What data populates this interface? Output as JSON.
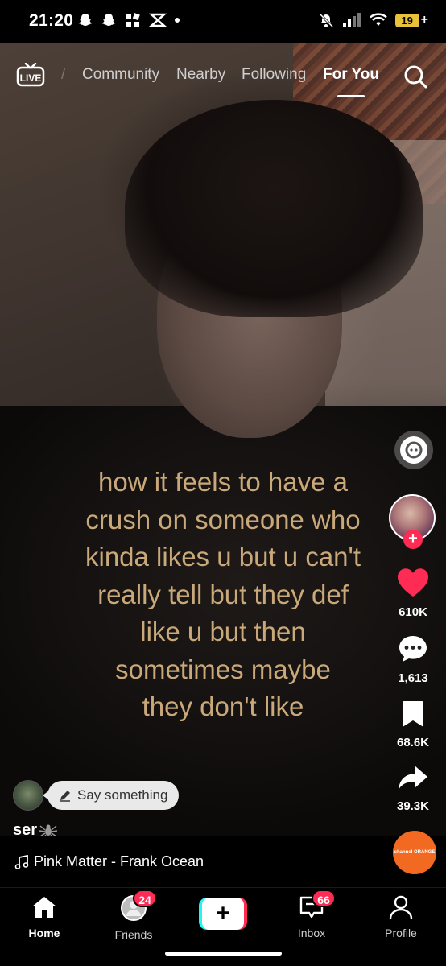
{
  "status_bar": {
    "time": "21:20",
    "left_icons": [
      "snapchat-icon",
      "snapchat-icon",
      "app-icon",
      "capcut-icon",
      "dot-icon"
    ],
    "battery": "19",
    "battery_charging": "+"
  },
  "top_nav": {
    "live_label": "LIVE",
    "tabs": [
      {
        "label": "Community"
      },
      {
        "label": "Nearby"
      },
      {
        "label": "Following"
      },
      {
        "label": "For You",
        "active": true
      }
    ]
  },
  "caption": {
    "lines": [
      "how it feels to have a",
      "crush on someone who",
      "kinda likes u but u can't",
      "really tell but they def",
      "like u but then",
      "sometimes maybe",
      "they don't like"
    ]
  },
  "rail": {
    "likes": "610K",
    "comments": "1,613",
    "saves": "68.6K",
    "shares": "39.3K"
  },
  "comment_prompt": {
    "placeholder": "Say something"
  },
  "author": {
    "username": "ser"
  },
  "music": {
    "title": "Pink Matter - Frank Ocean",
    "disc_label": "channel ORANGE"
  },
  "tab_bar": {
    "items": [
      {
        "label": "Home",
        "active": true
      },
      {
        "label": "Friends",
        "badge": "24"
      },
      {
        "label": ""
      },
      {
        "label": "Inbox",
        "badge": "66"
      },
      {
        "label": "Profile"
      }
    ]
  },
  "colors": {
    "caption": "#c9a87a",
    "accent_red": "#fe2c55",
    "accent_cyan": "#25f4ee"
  }
}
